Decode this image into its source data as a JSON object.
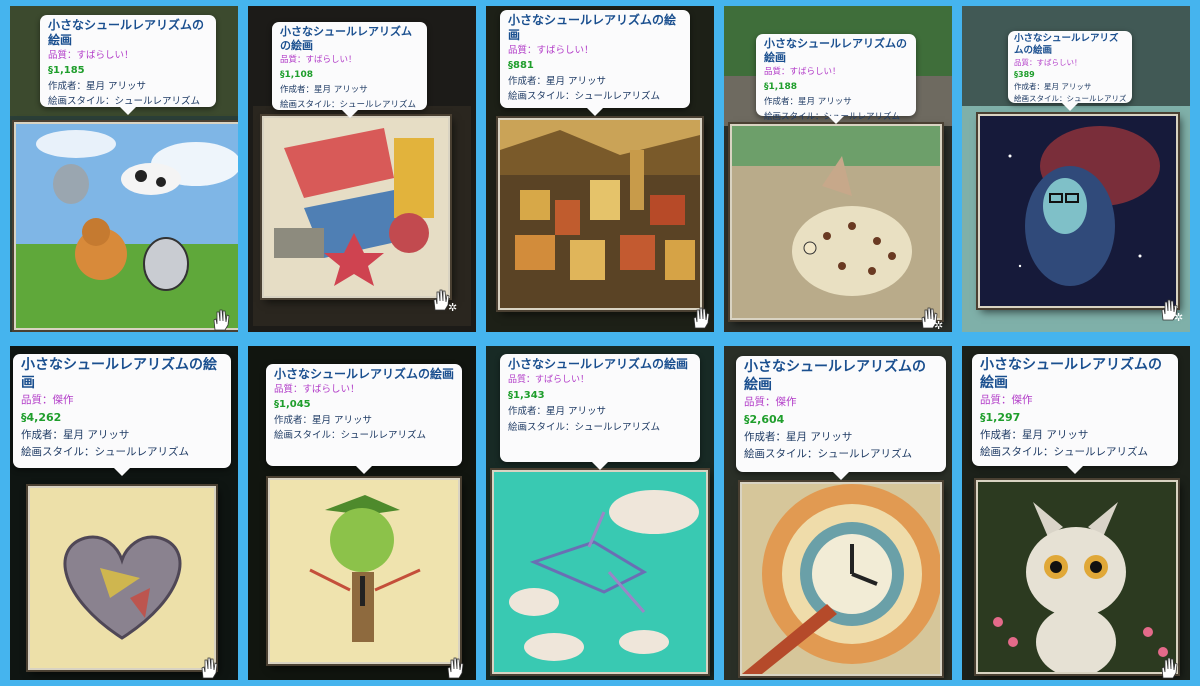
{
  "tooltip_defaults": {
    "title": "小さなシュールレアリズムの絵画",
    "artist": "作成者：星月 アリッサ",
    "style": "絵画スタイル：シュールレアリズム"
  },
  "cards": [
    {
      "quality": "品質：すばらしい！",
      "price": "1,185",
      "painting": "cow-cat-dog-cloud"
    },
    {
      "quality": "品質：すばらしい！",
      "price": "1,108",
      "painting": "abstract-shapes"
    },
    {
      "quality": "品質：すばらしい！",
      "price": "881",
      "painting": "town-landscape"
    },
    {
      "quality": "品質：すばらしい！",
      "price": "1,188",
      "painting": "pufferfish"
    },
    {
      "quality": "品質：すばらしい！",
      "price": "389",
      "painting": "galaxy-woman"
    },
    {
      "quality": "品質：傑作",
      "price": "4,262",
      "painting": "heart"
    },
    {
      "quality": "品質：すばらしい！",
      "price": "1,045",
      "painting": "green-head-figure"
    },
    {
      "quality": "品質：すばらしい！",
      "price": "1,343",
      "painting": "flying-bird-sky"
    },
    {
      "quality": "品質：傑作",
      "price": "2,604",
      "painting": "clock-rings"
    },
    {
      "quality": "品質：傑作",
      "price": "1,297",
      "painting": "white-cat-flowers"
    }
  ],
  "currency_symbol": "§",
  "colors": {
    "background": "#45b4ee",
    "title": "#1a4f8f",
    "quality": "#b23cc8",
    "price": "#1f9e2c",
    "meta": "#1f3b64"
  }
}
